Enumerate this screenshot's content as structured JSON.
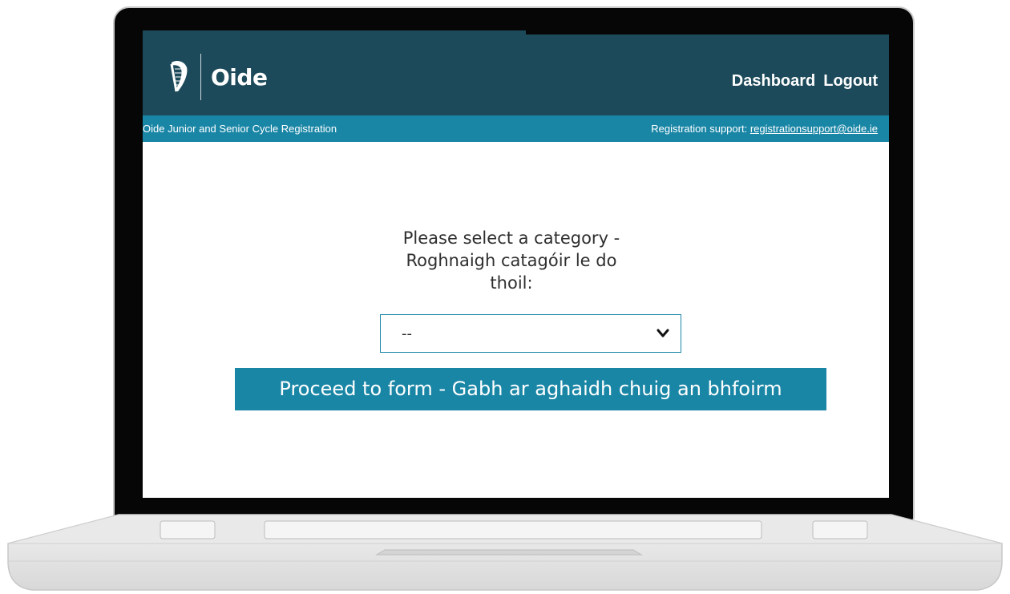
{
  "app": {
    "logo_text": "Oide",
    "nav": {
      "dashboard": "Dashboard",
      "logout": "Logout"
    }
  },
  "subbar": {
    "title": "Oide Junior and Senior Cycle Registration",
    "support_label": "Registration support: ",
    "support_email": "registrationsupport@oide.ie"
  },
  "main": {
    "prompt_lines": [
      "Please select a category -",
      "Roghnaigh catagóir le do",
      "thoil:"
    ],
    "category_select": {
      "value": "--"
    },
    "proceed_label": "Proceed to form - Gabh ar aghaidh chuig an bhfoirm"
  },
  "colors": {
    "header_dark": "#1d4a5a",
    "header_accent": "#1a86a6",
    "button": "#1a86a6"
  },
  "icons": {
    "logo": "harp-icon",
    "select": "chevron-down-icon"
  }
}
